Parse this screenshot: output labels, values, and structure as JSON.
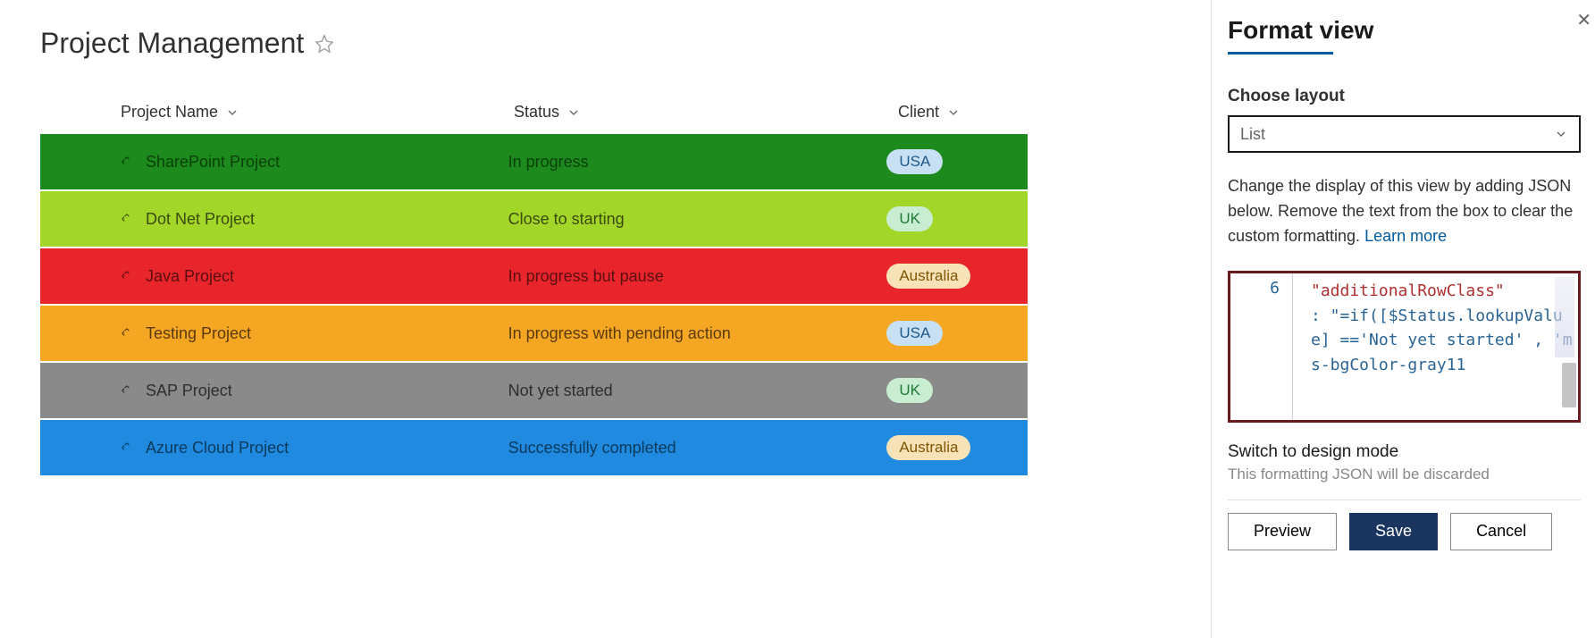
{
  "header": {
    "title": "Project Management"
  },
  "table": {
    "columns": {
      "project": "Project Name",
      "status": "Status",
      "client": "Client"
    },
    "rows": [
      {
        "project": "SharePoint Project",
        "status": "In progress",
        "client": "USA",
        "bg": "bg-green",
        "pill": "pill-blue"
      },
      {
        "project": "Dot Net Project",
        "status": "Close to starting",
        "client": "UK",
        "bg": "bg-lime",
        "pill": "pill-green"
      },
      {
        "project": "Java Project",
        "status": "In progress but pause",
        "client": "Australia",
        "bg": "bg-red",
        "pill": "pill-peach"
      },
      {
        "project": "Testing Project",
        "status": "In progress with pending action",
        "client": "USA",
        "bg": "bg-orange",
        "pill": "pill-blue"
      },
      {
        "project": "SAP Project",
        "status": "Not yet started",
        "client": "UK",
        "bg": "bg-gray",
        "pill": "pill-green"
      },
      {
        "project": "Azure Cloud Project",
        "status": "Successfully completed",
        "client": "Australia",
        "bg": "bg-blue",
        "pill": "pill-peach"
      }
    ]
  },
  "panel": {
    "title": "Format view",
    "choose_label": "Choose layout",
    "layout_value": "List",
    "description_prefix": "Change the display of this view by adding JSON below. Remove the text from the box to clear the custom formatting. ",
    "learn_more": "Learn more",
    "code_line_number": "6",
    "code_key": "\"additionalRowClass\"",
    "code_rest": ": \"=if([$Status.lookupValue] =='Not yet started' , 'ms-bgColor-gray11",
    "switch_text": "Switch to design mode",
    "switch_sub": "This formatting JSON will be discarded",
    "buttons": {
      "preview": "Preview",
      "save": "Save",
      "cancel": "Cancel"
    }
  }
}
